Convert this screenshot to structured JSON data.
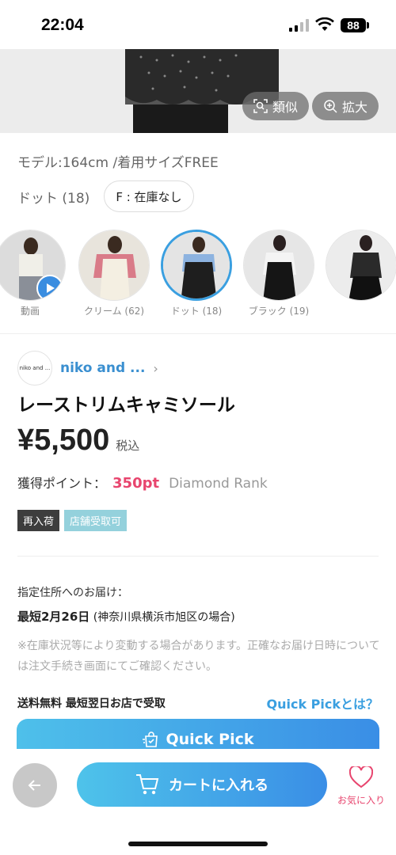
{
  "status_bar": {
    "time": "22:04",
    "battery": "88"
  },
  "hero": {
    "similar_label": "類似",
    "zoom_label": "拡大"
  },
  "product_meta": {
    "model_info": "モデル:164cm /着用サイズFREE",
    "selected_variant": "ドット (18)",
    "size_chip": "F : 在庫なし"
  },
  "swatches": [
    {
      "label": "動画",
      "type": "video"
    },
    {
      "label": "クリーム (62)",
      "type": "color"
    },
    {
      "label": "ドット (18)",
      "type": "color",
      "selected": true
    },
    {
      "label": "ブラック (19)",
      "type": "color"
    },
    {
      "label": "",
      "type": "color"
    }
  ],
  "brand": {
    "logo_text": "niko and ...",
    "name": "niko and ..."
  },
  "product": {
    "title": "レーストリムキャミソール",
    "price": "¥5,500",
    "tax_label": "税込",
    "points_label": "獲得ポイント：",
    "points_value": "350pt",
    "rank": "Diamond Rank"
  },
  "tags": [
    "再入荷",
    "店舗受取可"
  ],
  "delivery": {
    "label": "指定住所へのお届け：",
    "date_bold": "最短2月26日",
    "date_note": "(神奈川県横浜市旭区の場合)",
    "note": "※在庫状況等により変動する場合があります。正確なお届け日時については注文手続き画面にてご確認ください。"
  },
  "shipping": {
    "text": "送料無料 最短翌日お店で受取",
    "quick_pick_link": "Quick Pickとは？",
    "quick_pick_button": "Quick Pick"
  },
  "bottom_bar": {
    "back_icon": "arrow-left-icon",
    "cart_label": "カートに入れる",
    "favorite_label": "お気に入り"
  },
  "colors": {
    "accent_blue": "#3a9fe0",
    "points_pink": "#e8456e",
    "tag_dark": "#3d3d3d",
    "tag_teal": "#94d1dc"
  }
}
